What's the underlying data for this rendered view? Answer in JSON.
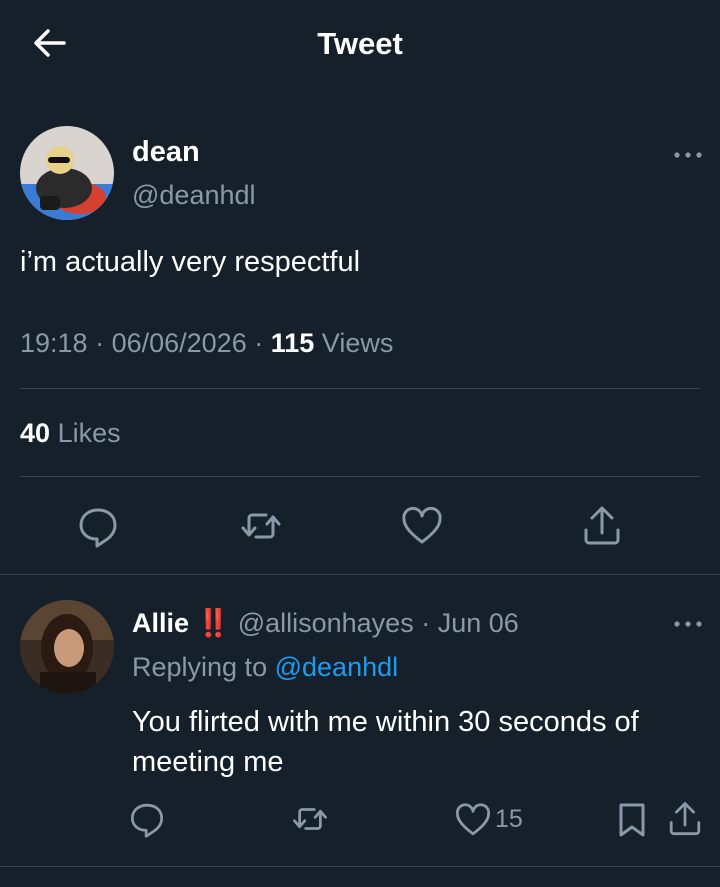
{
  "header": {
    "title": "Tweet",
    "back_icon": "arrow-left-icon"
  },
  "tweet": {
    "author_name": "dean",
    "author_handle": "@deanhdl",
    "text": "i’m actually very respectful",
    "time": "19:18",
    "date": "06/06/2026",
    "views_count": "115",
    "views_label": "Views",
    "likes_count": "40",
    "likes_label": "Likes",
    "actions": [
      "reply-icon",
      "retweet-icon",
      "like-icon",
      "share-icon"
    ]
  },
  "reply": {
    "author_name": "Allie",
    "author_badge": "‼️",
    "author_handle": "@allisonhayes",
    "date": "Jun 06",
    "replying_prefix": "Replying to",
    "replying_to": "@deanhdl",
    "text": "You flirted with me within 30 seconds of meeting me",
    "like_count": "15",
    "actions": [
      "reply-icon",
      "retweet-icon",
      "like-icon",
      "bookmark-icon",
      "share-icon"
    ]
  },
  "colors": {
    "background": "#15202b",
    "muted": "#8b98a5",
    "accent": "#1d9bf0",
    "divider": "#38444d",
    "badge": "#e0245e"
  }
}
